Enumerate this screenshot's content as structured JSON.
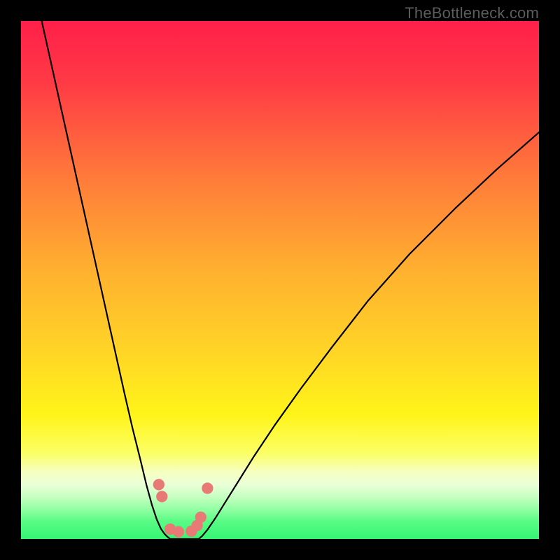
{
  "watermark": "TheBottleneck.com",
  "colors": {
    "black": "#000000",
    "curve_stroke": "#000000",
    "dot_fill": "#e77a74",
    "green_band": "#34f673"
  },
  "gradient_stops": [
    {
      "offset": 0.0,
      "color": "#ff1f49"
    },
    {
      "offset": 0.12,
      "color": "#ff3a45"
    },
    {
      "offset": 0.3,
      "color": "#ff7a3a"
    },
    {
      "offset": 0.48,
      "color": "#ffb02f"
    },
    {
      "offset": 0.63,
      "color": "#ffd327"
    },
    {
      "offset": 0.76,
      "color": "#fff419"
    },
    {
      "offset": 0.835,
      "color": "#fbff66"
    },
    {
      "offset": 0.87,
      "color": "#f6ffc0"
    },
    {
      "offset": 0.895,
      "color": "#eaffd8"
    },
    {
      "offset": 0.92,
      "color": "#c3ffbf"
    },
    {
      "offset": 0.945,
      "color": "#8cffa0"
    },
    {
      "offset": 0.965,
      "color": "#5bfb85"
    },
    {
      "offset": 1.0,
      "color": "#34f673"
    }
  ],
  "chart_data": {
    "type": "line",
    "title": "",
    "xlabel": "",
    "ylabel": "",
    "xlim": [
      0,
      100
    ],
    "ylim": [
      0,
      100
    ],
    "series": [
      {
        "name": "left-curve",
        "x": [
          4.0,
          8.0,
          12.0,
          16.0,
          18.0,
          20.0,
          21.5,
          23.0,
          24.2,
          25.3,
          26.2,
          27.0,
          27.7,
          28.3,
          28.8
        ],
        "y": [
          100.0,
          82.0,
          64.0,
          46.0,
          37.0,
          28.0,
          21.5,
          15.5,
          10.5,
          6.5,
          3.8,
          2.0,
          1.0,
          0.4,
          0.0
        ]
      },
      {
        "name": "valley-floor",
        "x": [
          28.8,
          30.0,
          31.5,
          33.0,
          34.3
        ],
        "y": [
          0.0,
          0.0,
          0.0,
          0.0,
          0.0
        ]
      },
      {
        "name": "right-curve",
        "x": [
          34.3,
          35.0,
          36.0,
          37.5,
          39.5,
          42.0,
          45.0,
          49.0,
          54.0,
          60.0,
          67.0,
          75.0,
          84.0,
          92.0,
          100.0
        ],
        "y": [
          0.0,
          0.6,
          1.8,
          4.0,
          7.2,
          11.2,
          16.0,
          22.0,
          29.0,
          37.0,
          46.0,
          55.0,
          64.0,
          71.5,
          78.5
        ]
      }
    ],
    "points": [
      {
        "name": "dot-left-upper",
        "x": 26.6,
        "y": 10.5,
        "r": 1.1
      },
      {
        "name": "dot-left-lower",
        "x": 27.2,
        "y": 8.2,
        "r": 1.1
      },
      {
        "name": "dot-floor-1",
        "x": 28.8,
        "y": 1.9,
        "r": 1.1
      },
      {
        "name": "dot-floor-2",
        "x": 30.4,
        "y": 1.4,
        "r": 1.1
      },
      {
        "name": "dot-floor-3",
        "x": 32.9,
        "y": 1.5,
        "r": 1.1
      },
      {
        "name": "dot-right-lower",
        "x": 34.0,
        "y": 2.6,
        "r": 1.1
      },
      {
        "name": "dot-right-mid",
        "x": 34.7,
        "y": 4.2,
        "r": 1.1
      },
      {
        "name": "dot-right-upper",
        "x": 36.0,
        "y": 9.8,
        "r": 1.1
      }
    ]
  }
}
